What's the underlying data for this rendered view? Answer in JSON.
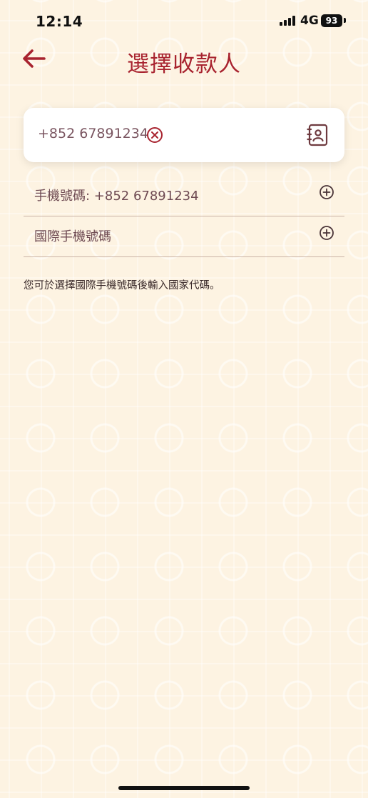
{
  "status_bar": {
    "time": "12:14",
    "network": "4G",
    "battery": "93"
  },
  "header": {
    "title": "選擇收款人",
    "back_icon": "arrow-left-icon"
  },
  "search": {
    "value": "+852 67891234",
    "clear_icon": "clear-circle-x-icon",
    "contacts_icon": "contacts-book-icon"
  },
  "results": [
    {
      "label": "手機號碼: +852 67891234",
      "icon": "plus-circle-icon"
    },
    {
      "label": "國際手機號碼",
      "icon": "plus-circle-icon"
    }
  ],
  "hint": "您可於選擇國際手機號碼後輸入國家代碼。",
  "colors": {
    "accent": "#a8232f",
    "background": "#fdf3e2",
    "row_text": "#6e4a52"
  }
}
